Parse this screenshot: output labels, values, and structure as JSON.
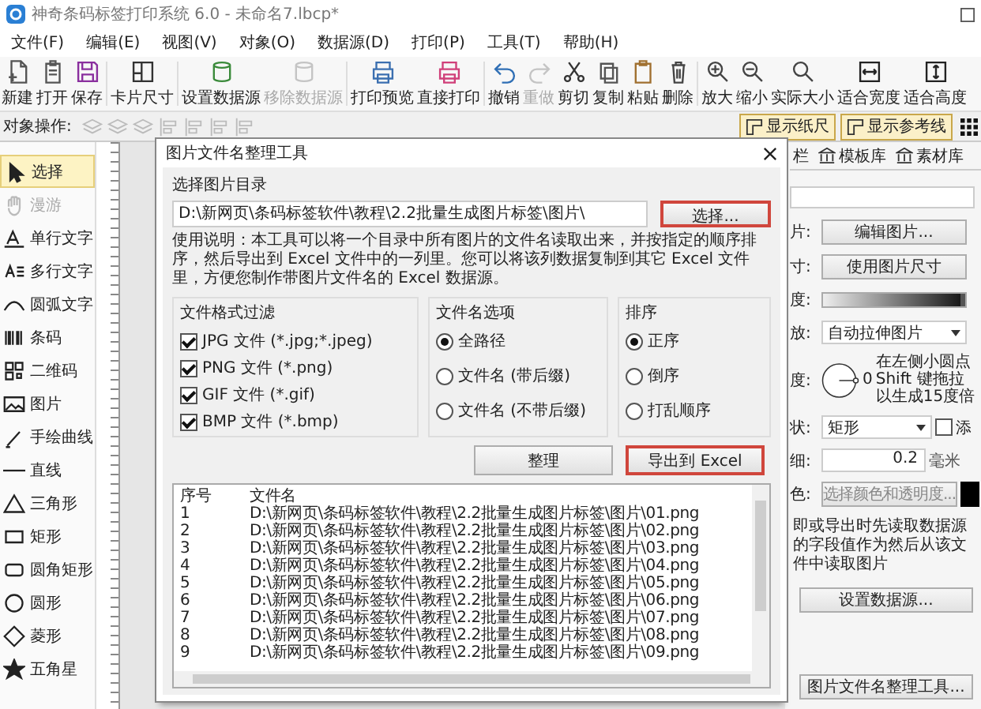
{
  "window": {
    "title": "神奇条码标签打印系统 6.0 - 未命名7.lbcp*"
  },
  "menu": [
    "文件(F)",
    "编辑(E)",
    "视图(V)",
    "对象(O)",
    "数据源(D)",
    "打印(P)",
    "工具(T)",
    "帮助(H)"
  ],
  "toolbar": [
    {
      "label": "新建",
      "disabled": false
    },
    {
      "label": "打开",
      "disabled": false
    },
    {
      "label": "保存",
      "disabled": false
    },
    {
      "label": "卡片尺寸",
      "disabled": false
    },
    {
      "label": "设置数据源",
      "disabled": false
    },
    {
      "label": "移除数据源",
      "disabled": true
    },
    {
      "label": "打印预览",
      "disabled": false
    },
    {
      "label": "直接打印",
      "disabled": false
    },
    {
      "label": "撤销",
      "disabled": false
    },
    {
      "label": "重做",
      "disabled": true
    },
    {
      "label": "剪切",
      "disabled": false
    },
    {
      "label": "复制",
      "disabled": false
    },
    {
      "label": "粘贴",
      "disabled": false
    },
    {
      "label": "删除",
      "disabled": false
    },
    {
      "label": "放大",
      "disabled": false
    },
    {
      "label": "缩小",
      "disabled": false
    },
    {
      "label": "实际大小",
      "disabled": false
    },
    {
      "label": "适合宽度",
      "disabled": false
    },
    {
      "label": "适合高度",
      "disabled": false
    }
  ],
  "object_bar": {
    "label": "对象操作:",
    "toggles": [
      {
        "label": "显示纸尺",
        "on": true
      },
      {
        "label": "显示参考线",
        "on": true
      }
    ]
  },
  "tools": [
    {
      "label": "选择",
      "selected": true,
      "disabled": false
    },
    {
      "label": "漫游",
      "selected": false,
      "disabled": true
    },
    {
      "label": "单行文字",
      "selected": false,
      "disabled": false
    },
    {
      "label": "多行文字",
      "selected": false,
      "disabled": false
    },
    {
      "label": "圆弧文字",
      "selected": false,
      "disabled": false
    },
    {
      "label": "条码",
      "selected": false,
      "disabled": false
    },
    {
      "label": "二维码",
      "selected": false,
      "disabled": false
    },
    {
      "label": "图片",
      "selected": false,
      "disabled": false
    },
    {
      "label": "手绘曲线",
      "selected": false,
      "disabled": false
    },
    {
      "label": "直线",
      "selected": false,
      "disabled": false
    },
    {
      "label": "三角形",
      "selected": false,
      "disabled": false
    },
    {
      "label": "矩形",
      "selected": false,
      "disabled": false
    },
    {
      "label": "圆角矩形",
      "selected": false,
      "disabled": false
    },
    {
      "label": "圆形",
      "selected": false,
      "disabled": false
    },
    {
      "label": "菱形",
      "selected": false,
      "disabled": false
    },
    {
      "label": "五角星",
      "selected": false,
      "disabled": false
    }
  ],
  "right_panel": {
    "tabs": [
      "栏",
      "模板库",
      "素材库"
    ],
    "rows": [
      {
        "kind": "button",
        "label": "片:",
        "value": "编辑图片..."
      },
      {
        "kind": "button",
        "label": "寸:",
        "value": "使用图片尺寸"
      },
      {
        "kind": "slider",
        "label": "度:",
        "level": 1
      },
      {
        "kind": "dropdown",
        "label": "放:",
        "value": "自动拉伸图片"
      },
      {
        "kind": "angle",
        "label": "度:",
        "value": "0",
        "hint_lines": [
          "在左侧小圆点",
          "Shift 键拖拉",
          "以生成15度倍"
        ]
      },
      {
        "kind": "dropdown_check",
        "label": "状:",
        "value": "矩形",
        "checked": false,
        "check_label": "添"
      },
      {
        "kind": "spin",
        "label": "细:",
        "value": "0.2",
        "unit": "毫米"
      },
      {
        "kind": "color",
        "label": "色:",
        "value": "选择颜色和透明度...",
        "color": "#000000"
      }
    ],
    "note": "即或导出时先读取数据源的字段值作为然后从该文件中读取图片",
    "buttons": [
      "设置数据源...",
      "图片文件名整理工具..."
    ]
  },
  "dialog": {
    "title": "图片文件名整理工具",
    "dir_label": "选择图片目录",
    "dir_value": "D:\\新网页\\条码标签软件\\教程\\2.2批量生成图片标签\\图片\\",
    "browse_button": {
      "label": "选择...",
      "highlighted": true
    },
    "description": "使用说明：本工具可以将一个目录中所有图片的文件名读取出来，并按指定的顺序排序，然后导出到 Excel 文件中的一列里。您可以将该列数据复制到其它 Excel 文件里，方便您制作带图片文件名的 Excel 数据源。",
    "filter": {
      "title": "文件格式过滤",
      "items": [
        {
          "label": "JPG 文件 (*.jpg;*.jpeg)",
          "checked": true
        },
        {
          "label": "PNG 文件 (*.png)",
          "checked": true
        },
        {
          "label": "GIF 文件 (*.gif)",
          "checked": true
        },
        {
          "label": "BMP 文件 (*.bmp)",
          "checked": true
        }
      ]
    },
    "name_options": {
      "title": "文件名选项",
      "items": [
        {
          "label": "全路径",
          "selected": true
        },
        {
          "label": "文件名 (带后缀)",
          "selected": false
        },
        {
          "label": "文件名 (不带后缀)",
          "selected": false
        }
      ]
    },
    "sort": {
      "title": "排序",
      "items": [
        {
          "label": "正序",
          "selected": true
        },
        {
          "label": "倒序",
          "selected": false
        },
        {
          "label": "打乱顺序",
          "selected": false
        }
      ]
    },
    "buttons": [
      {
        "label": "整理",
        "highlighted": false
      },
      {
        "label": "导出到 Excel",
        "highlighted": true
      }
    ],
    "table": {
      "columns": [
        "序号",
        "文件名"
      ],
      "rows": [
        [
          "1",
          "D:\\新网页\\条码标签软件\\教程\\2.2批量生成图片标签\\图片\\01.png"
        ],
        [
          "2",
          "D:\\新网页\\条码标签软件\\教程\\2.2批量生成图片标签\\图片\\02.png"
        ],
        [
          "3",
          "D:\\新网页\\条码标签软件\\教程\\2.2批量生成图片标签\\图片\\03.png"
        ],
        [
          "4",
          "D:\\新网页\\条码标签软件\\教程\\2.2批量生成图片标签\\图片\\04.png"
        ],
        [
          "5",
          "D:\\新网页\\条码标签软件\\教程\\2.2批量生成图片标签\\图片\\05.png"
        ],
        [
          "6",
          "D:\\新网页\\条码标签软件\\教程\\2.2批量生成图片标签\\图片\\06.png"
        ],
        [
          "7",
          "D:\\新网页\\条码标签软件\\教程\\2.2批量生成图片标签\\图片\\07.png"
        ],
        [
          "8",
          "D:\\新网页\\条码标签软件\\教程\\2.2批量生成图片标签\\图片\\08.png"
        ],
        [
          "9",
          "D:\\新网页\\条码标签软件\\教程\\2.2批量生成图片标签\\图片\\09.png"
        ]
      ]
    }
  }
}
